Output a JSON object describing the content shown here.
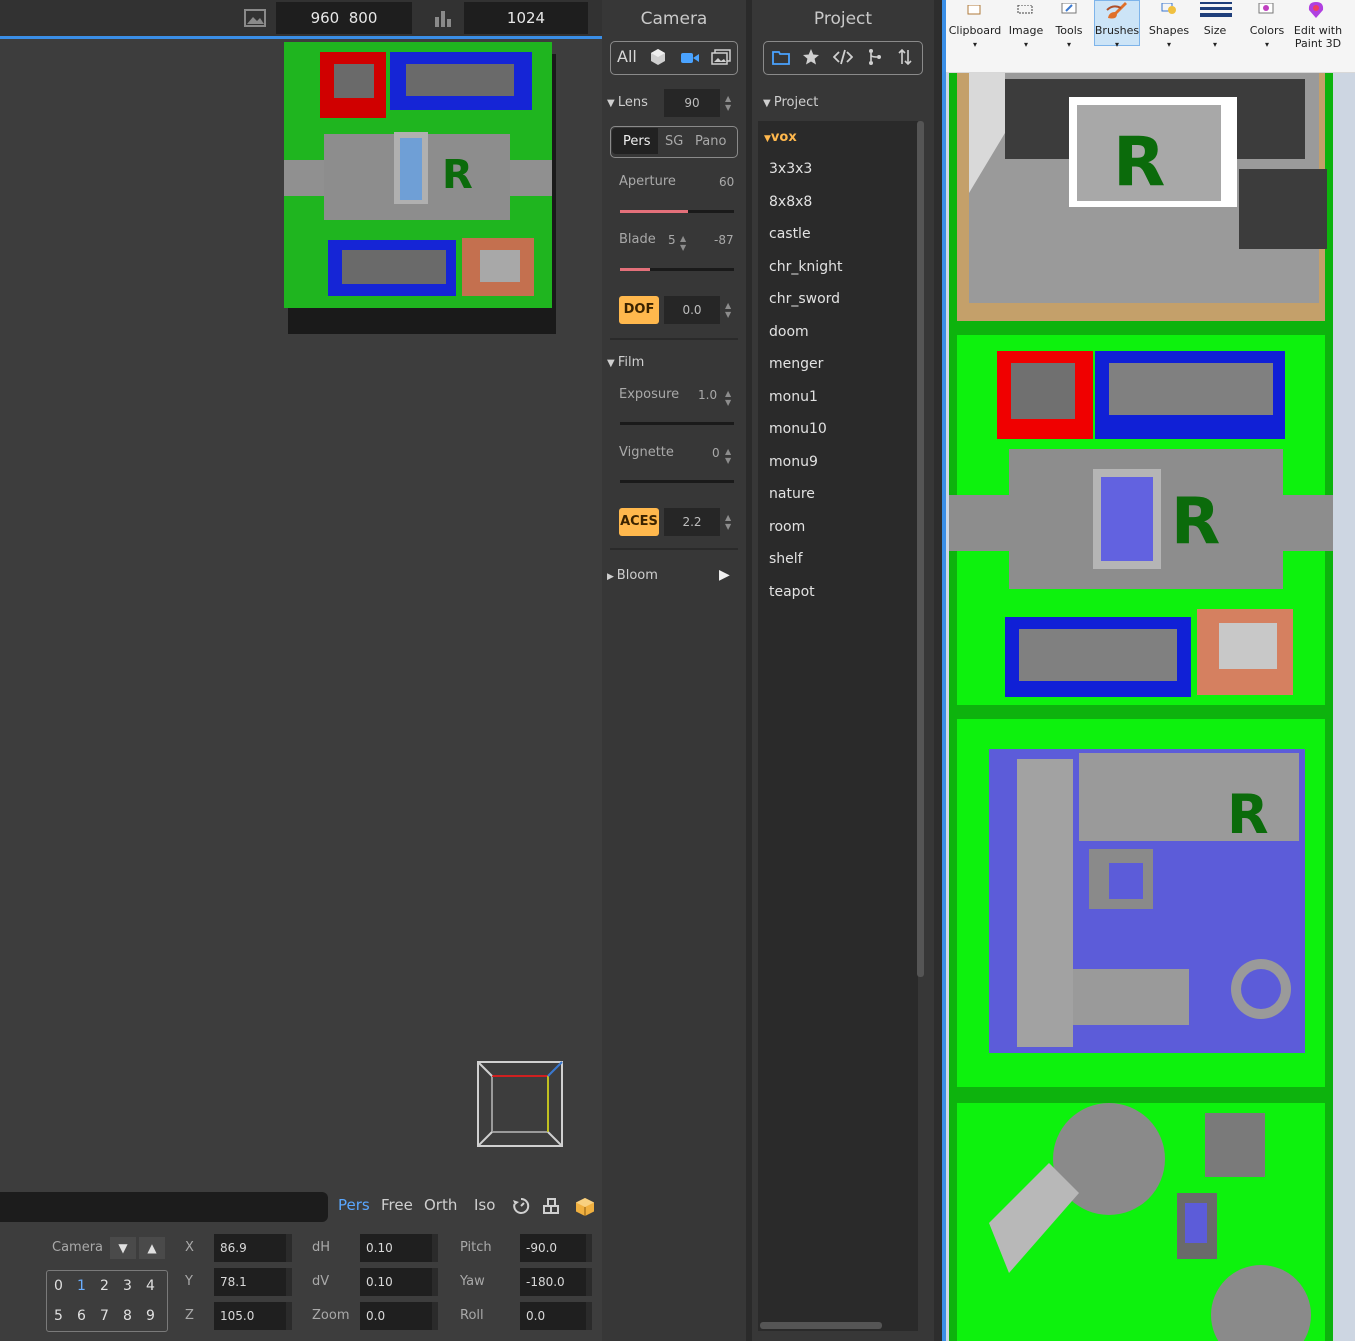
{
  "viewport": {
    "resolution_w": "960",
    "resolution_h": "800",
    "samples": "1024",
    "modes": [
      "Pers",
      "Free",
      "Orth",
      "Iso"
    ],
    "active_mode": "Pers"
  },
  "camera_controls": {
    "label": "Camera",
    "numpad": [
      "0",
      "1",
      "2",
      "3",
      "4",
      "5",
      "6",
      "7",
      "8",
      "9"
    ],
    "fields": {
      "x_label": "X",
      "x": "86.9",
      "y_label": "Y",
      "y": "78.1",
      "z_label": "Z",
      "z": "105.0",
      "dh_label": "dH",
      "dh": "0.10",
      "dv_label": "dV",
      "dv": "0.10",
      "zoom_label": "Zoom",
      "zoom": "0.0",
      "pitch_label": "Pitch",
      "pitch": "-90.0",
      "yaw_label": "Yaw",
      "yaw": "-180.0",
      "roll_label": "Roll",
      "roll": "0.0"
    }
  },
  "camera_panel": {
    "title": "Camera",
    "filter_all": "All",
    "lens": {
      "label": "Lens",
      "value": "90"
    },
    "projection_tabs": [
      "Pers",
      "SG",
      "Pano"
    ],
    "aperture": {
      "label": "Aperture",
      "value": "60",
      "fill": 0.6
    },
    "blade": {
      "label": "Blade",
      "count": "5",
      "value": "-87",
      "fill": 0.26
    },
    "dof": {
      "label": "DOF",
      "value": "0.0"
    },
    "film": {
      "label": "Film"
    },
    "exposure": {
      "label": "Exposure",
      "value": "1.0"
    },
    "vignette": {
      "label": "Vignette",
      "value": "0"
    },
    "aces": {
      "label": "ACES",
      "value": "2.2"
    },
    "bloom": {
      "label": "Bloom"
    }
  },
  "project_panel": {
    "title": "Project",
    "section": "Project",
    "folder": "vox",
    "items": [
      "3x3x3",
      "8x8x8",
      "castle",
      "chr_knight",
      "chr_sword",
      "doom",
      "menger",
      "monu1",
      "monu10",
      "monu9",
      "nature",
      "room",
      "shelf",
      "teapot"
    ]
  },
  "paint": {
    "ribbon": [
      "Clipboard",
      "Image",
      "Tools",
      "Brushes",
      "Shapes",
      "Size",
      "Colors",
      "Edit with"
    ],
    "edit_with_line2": "Paint 3D",
    "active": "Brushes"
  }
}
